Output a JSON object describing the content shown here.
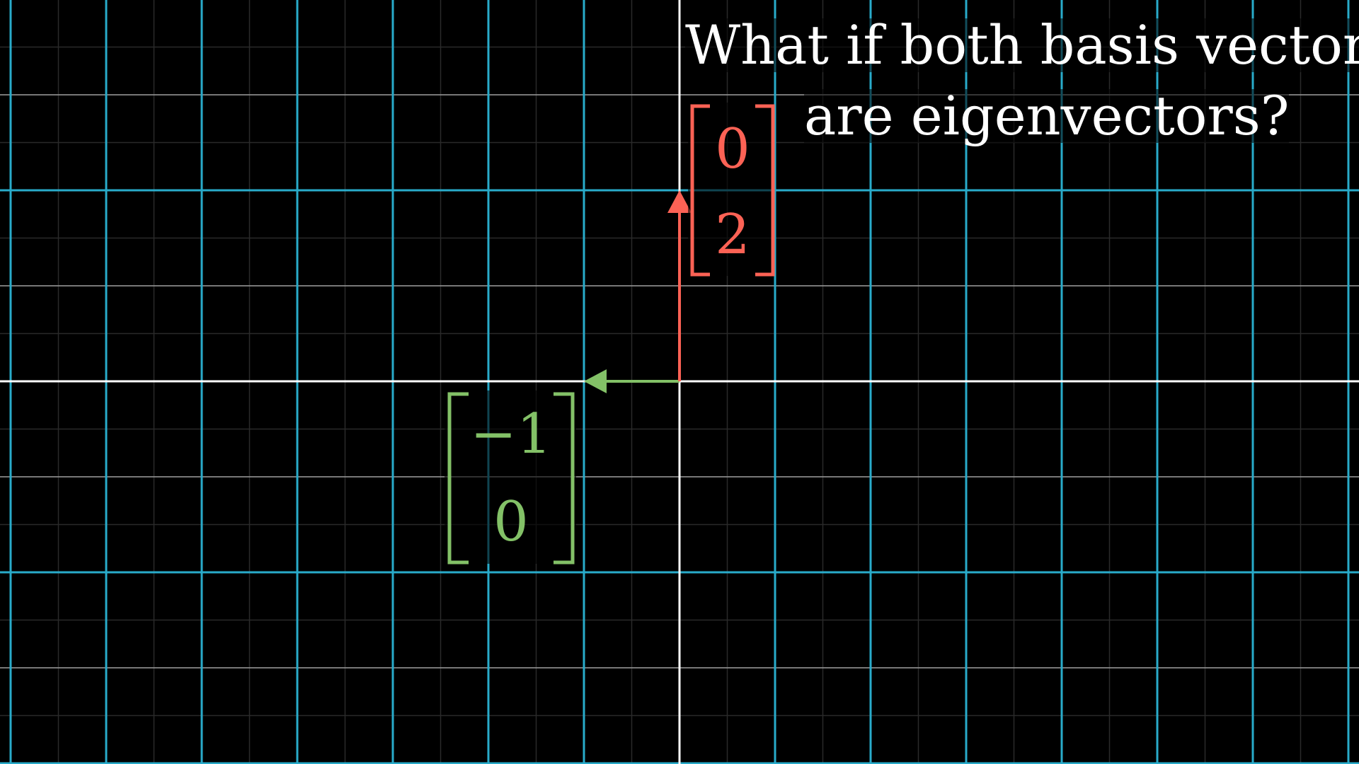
{
  "caption": {
    "line1": "What if both basis vectors",
    "line2": "are eigenvectors?"
  },
  "vectors": {
    "j_hat": {
      "entries": [
        "0",
        "2"
      ],
      "value": [
        0,
        2
      ],
      "color": "#FC6255"
    },
    "i_hat": {
      "entries": [
        "−1",
        "0"
      ],
      "value": [
        -1,
        0
      ],
      "color": "#83C167"
    }
  },
  "colors": {
    "background": "#000000",
    "grid_line": "#29ABCA",
    "axis": "#FFFFFF"
  }
}
